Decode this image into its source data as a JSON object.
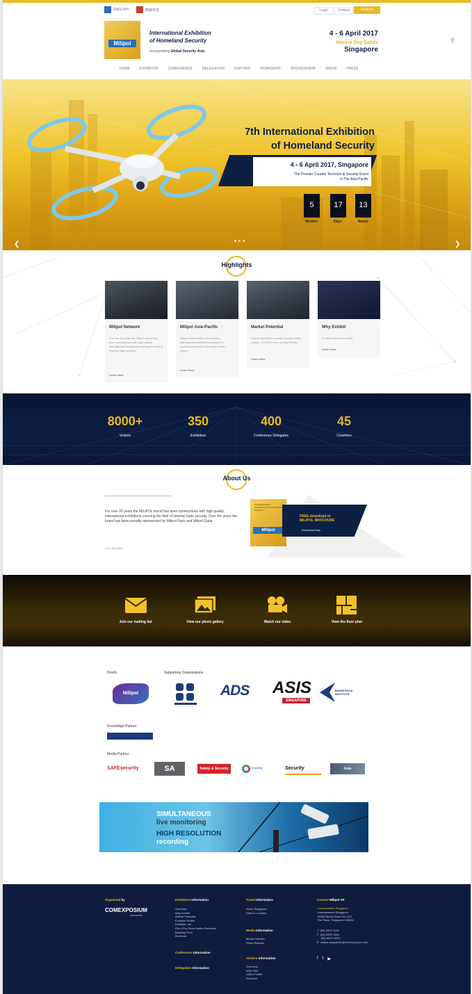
{
  "header": {
    "lang_en": "ENGLISH",
    "lang_cn": "简体中文",
    "top_links": [
      "Login",
      "Contact"
    ],
    "register_label": "Register",
    "logo_text": "Milipol",
    "brand_title_line1": "International Exhibition",
    "brand_title_line2": "of Homeland Security",
    "tagline_prefix": "Incorporating",
    "tagline_bold": "Global Security Asia",
    "event_date": "4 - 6 April 2017",
    "event_venue": "Marina Bay Sands",
    "event_city": "Singapore"
  },
  "nav": [
    "HOME",
    "EXHIBITOR",
    "CONFERENCE",
    "DELEGATION",
    "VISITORS",
    "WORKSHOP",
    "SPONSORSHIP",
    "MEDIA",
    "PRESS"
  ],
  "hero": {
    "title_line1": "7th International Exhibition",
    "title_line2": "of Homeland Security",
    "date": "4 - 6 April 2017, Singapore",
    "subtitle_line1": "The Premier Counter Terrorism & Security Event",
    "subtitle_line2": "in The Asia Pacific",
    "countdown": [
      {
        "value": "5",
        "label": "Months"
      },
      {
        "value": "17",
        "label": "Days"
      },
      {
        "value": "13",
        "label": "Hours"
      }
    ]
  },
  "highlights": {
    "title": "Highlights",
    "cards": [
      {
        "title": "Milipol Network",
        "desc": "For over 20 years the Milipol brand has been synonymous with high quality international exhibitions covering the field of internal State security.",
        "link": "Learn More"
      },
      {
        "title": "Milipol Asia-Pacific",
        "desc": "Milipol Asia-Pacific is the leading international exhibition dedicated to homeland security in the Asia-Pacific region.",
        "link": "Learn More"
      },
      {
        "title": "Market Potential",
        "desc": "Global homeland security & public safety market - $ 2020 Focus on Asia Pacific",
        "link": "Learn More"
      },
      {
        "title": "Why Exhibit",
        "desc": "5 main reasons to exhibit",
        "link": "Learn More"
      }
    ]
  },
  "stats": [
    {
      "value": "8000+",
      "label": "Visitors"
    },
    {
      "value": "350",
      "label": "Exhibitors"
    },
    {
      "value": "400",
      "label": "Conference Delegates"
    },
    {
      "value": "45",
      "label": "Countries"
    }
  ],
  "about": {
    "title": "About Us",
    "text": "For over 20 years the MILIPOL brand has been synonymous with high quality, international exhibitions covering the field of internal State security. Over the years the brand has been proudly represented by Milipol Paris and Milipol Qatar.",
    "read_more": "Find Out More",
    "brochure_title": "INTERNATIONAL EXHIBITION OF HOMELAND SECURITY",
    "brochure_logo": "Milipol",
    "download_heading_1": "FREE download of",
    "download_heading_2": "MILIPOL BROCHURE",
    "download_now": "Download Now"
  },
  "cta": [
    {
      "label": "Join our mailing list",
      "icon": "envelope-icon"
    },
    {
      "label": "View our photo gallery",
      "icon": "photos-icon"
    },
    {
      "label": "Watch our video",
      "icon": "video-camera-icon"
    },
    {
      "label": "View the floor plan",
      "icon": "floor-plan-icon"
    }
  ],
  "partners": {
    "hosts_label": "Host/s",
    "supporting_label": "Supporting Organisations",
    "knowledge_label": "Knowledge Partner",
    "media_label": "Media Partner",
    "host_logo": "Milipol",
    "supporting_logos": [
      "ADS",
      "ASIS",
      "BIOMETRICS INSTITUTE"
    ],
    "asis_sub": "SINGAPORE",
    "media_logos": [
      "SAFEsecurity",
      "SA",
      "Safety & Security",
      "Security",
      "Security",
      "Asia"
    ]
  },
  "banner": {
    "line1": "SIMULTANEOUS",
    "line2": "live monitoring",
    "line3": "HIGH RESOLUTION",
    "line4": "recording"
  },
  "footer": {
    "organised_label": "Organised",
    "organised_by": "by",
    "organiser_logo": "COMEXPOSIUM",
    "organiser_sub": "SINGAPORE",
    "exhibitors_h": "Exhibitors",
    "exhibitors_hs": "Information",
    "exhibitor_links": "Overview\nWhy Exhibit\nMarket Potential\nExhibitor Profile\nExhibitor List\nFile a Pre-Show Notice Reminder\nBooking Form\nBrochure",
    "conference_h": "Conference",
    "conference_hs": "Information",
    "delegation_h": "Delegation",
    "delegation_hs": "Information",
    "travel_h": "Travel",
    "travel_hs": "Information",
    "travel_links": "About Singapore\nHotel & Location",
    "media_h": "Media",
    "media_hs": "Information",
    "media_links": "Media Partners\nPress Release",
    "visitors_h": "Visitors",
    "visitors_hs": "Information",
    "visitor_links": "Overview\nWhy Visit\nVisitor Profile\nBrochure",
    "contact_h": "Contact",
    "contact_hs": "Milipol AP",
    "contact_name": "Comexposium Singapore",
    "contact_addr": "Comexposium Singapore\n7500A Beach Road #11-312\nThe Plaza, Singapore 199591",
    "contact_phones": "T  (65) 6392 0136\nF  (65) 6392 1554\n     (65) 6392 0933\nE  milipol.asiapacific@comexposium.com"
  }
}
